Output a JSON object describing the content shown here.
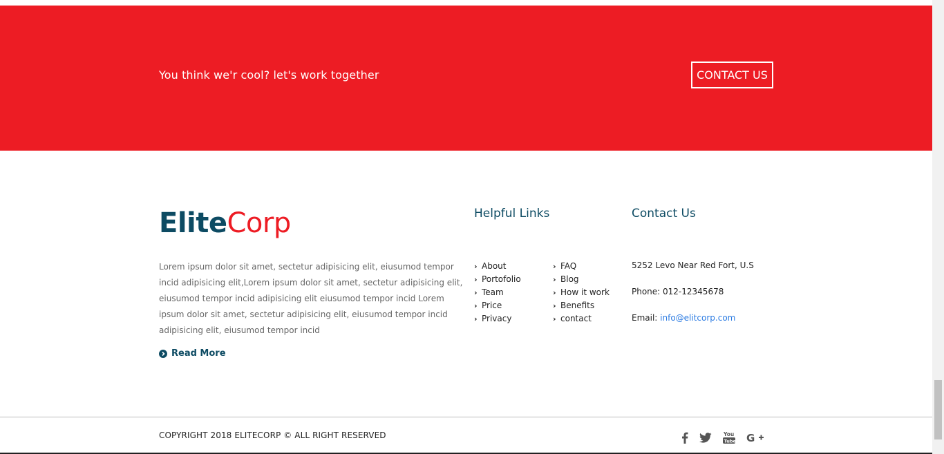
{
  "cta": {
    "text": "You think we'r cool? let's work together",
    "button_label": "CONTACT US"
  },
  "brand": {
    "part1": "Elite",
    "part2": "Corp"
  },
  "about": {
    "text": "Lorem ipsum dolor sit amet, sectetur adipisicing elit, eiusumod tempor incid adipisicing elit,Lorem ipsum dolor sit amet, sectetur adipisicing elit, eiusumod tempor incid adipisicing elit eiusumod tempor incid Lorem ipsum dolor sit amet, sectetur adipisicing elit, eiusumod tempor incid adipisicing elit, eiusumod tempor incid",
    "read_more": "Read More"
  },
  "helpful_links": {
    "title": "Helpful Links",
    "col1": [
      "About",
      "Portofolio",
      "Team",
      "Price",
      "Privacy"
    ],
    "col2": [
      "FAQ",
      "Blog",
      "How it work",
      "Benefits",
      "contact"
    ]
  },
  "contact": {
    "title": "Contact Us",
    "address": "5252 Levo Near Red Fort, U.S",
    "phone": "Phone: 012-12345678",
    "email_label": "Email: ",
    "email": "info@elitcorp.com"
  },
  "footer": {
    "copyright": "COPYRIGHT 2018 ELITECORP © ALL RIGHT RESERVED",
    "socials": [
      "facebook-icon",
      "twitter-icon",
      "youtube-icon",
      "google-plus-icon"
    ]
  },
  "colors": {
    "accent_red": "#ed1c24",
    "brand_blue": "#0d4b63",
    "link_blue": "#2a7ae2"
  }
}
